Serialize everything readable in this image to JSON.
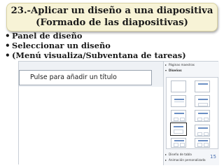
{
  "slide": {
    "title_line1": "23.-Aplicar un diseño a una diapositiva",
    "title_line2": "(Formado de las diapositivas)",
    "bullets": [
      "Panel de diseño",
      "Seleccionar un diseño",
      "(Menú visualiza/Subventana de tareas)"
    ],
    "page_number": "15"
  },
  "screenshot": {
    "placeholder_text": "Pulse para añadir un título",
    "task_pane": {
      "sections": [
        {
          "label": "Páginas maestras",
          "expanded": false
        },
        {
          "label": "Diseños",
          "expanded": true
        },
        {
          "label": "Diseño de tabla",
          "expanded": false
        },
        {
          "label": "Animación personalizada",
          "expanded": false
        }
      ],
      "layouts": [
        "blank",
        "title-only",
        "title-content",
        "title-content-dark",
        "title-two-content",
        "title-two-content-b",
        "title-content-selected",
        "title-two-content-c",
        "four-content",
        "title-two-content-d",
        "six-content",
        "vertical-title"
      ],
      "selected_layout": "title-content-selected"
    }
  }
}
